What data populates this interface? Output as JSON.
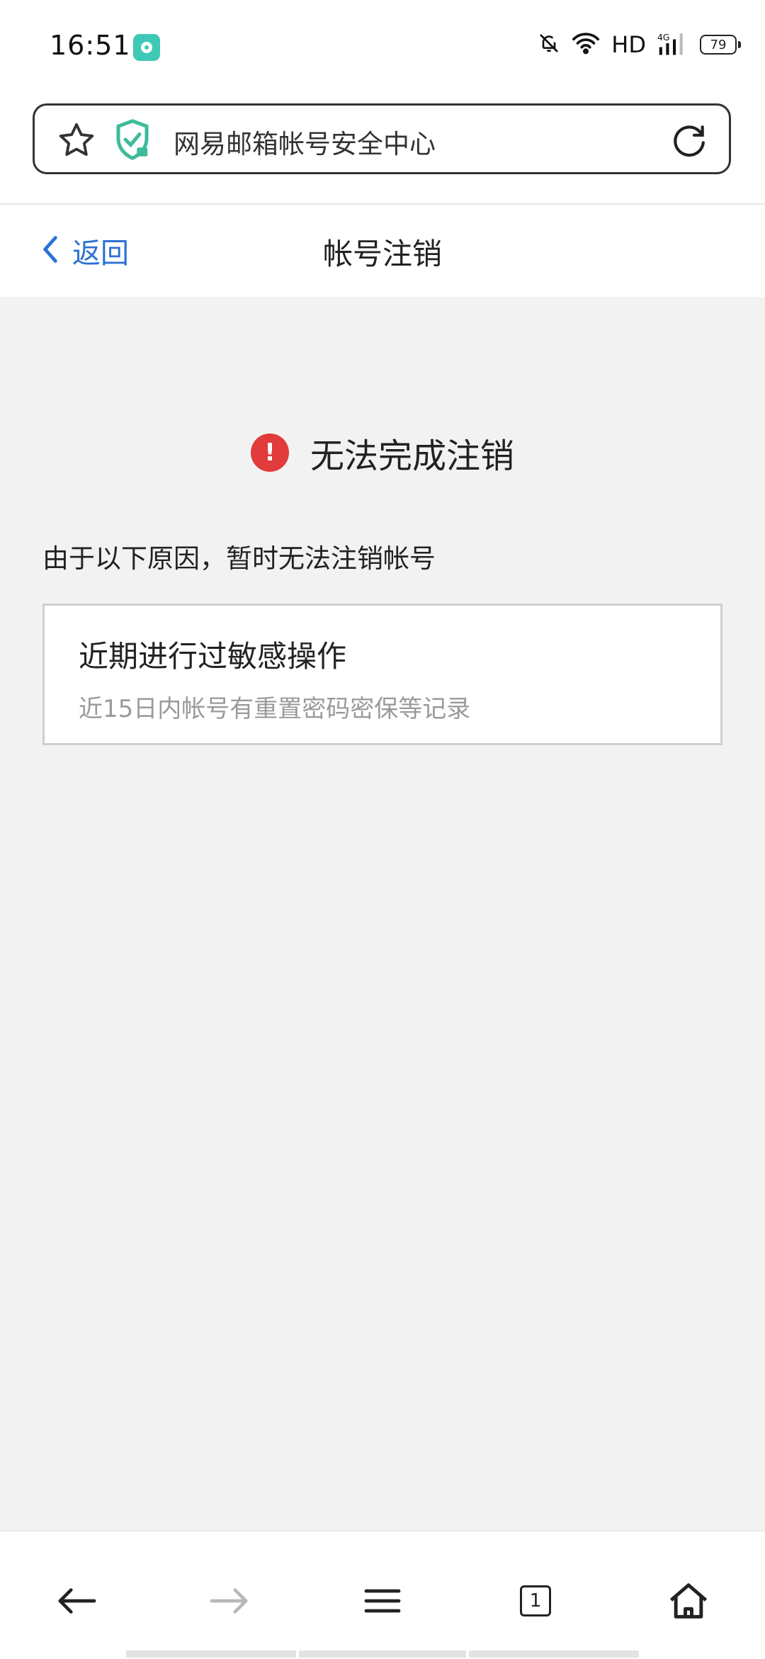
{
  "status_bar": {
    "time": "16:51",
    "network": "HD",
    "battery": "79",
    "icons": [
      "app-notification-icon",
      "bell-muted-icon",
      "wifi-icon",
      "signal-4g-icon",
      "battery-icon"
    ]
  },
  "address_bar": {
    "text": "网易邮箱帐号安全中心",
    "icons": [
      "star-icon",
      "shield-check-icon",
      "refresh-icon"
    ],
    "shield_color": "#3dbb9a"
  },
  "nav": {
    "back_label": "返回",
    "title": "帐号注销"
  },
  "main": {
    "error_title": "无法完成注销",
    "reason_intro": "由于以下原因，暂时无法注销帐号",
    "reasons": [
      {
        "title": "近期进行过敏感操作",
        "desc": "近15日内帐号有重置密码密保等记录"
      }
    ]
  },
  "bottom_bar": {
    "tab_count": "1",
    "icons": [
      "back-arrow-icon",
      "forward-arrow-icon",
      "menu-icon",
      "tabs-icon",
      "home-icon"
    ]
  },
  "colors": {
    "accent": "#2c72d3",
    "error": "#e23b3b",
    "background": "#f2f2f2"
  }
}
